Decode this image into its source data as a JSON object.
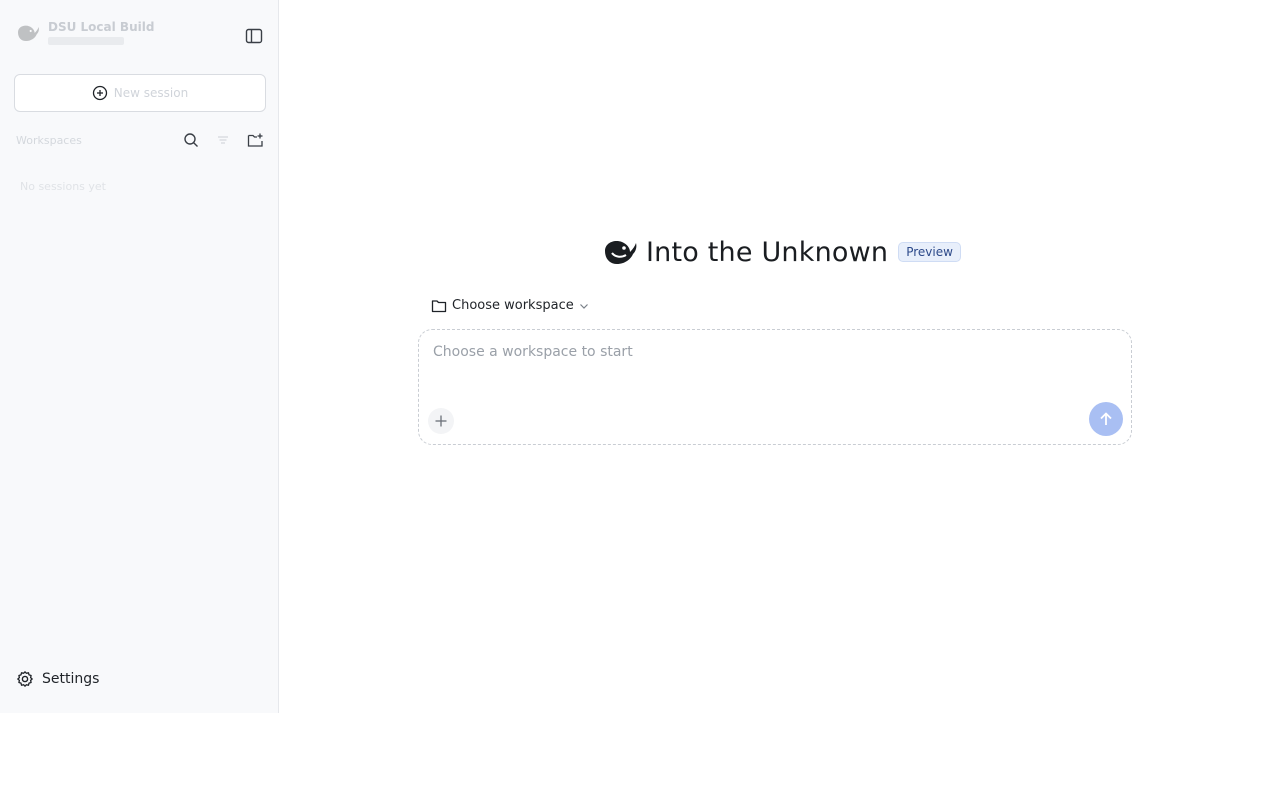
{
  "sidebar": {
    "brand_title": "DSU Local Build",
    "new_session_label": "New session",
    "section_label": "Workspaces",
    "empty_hint": "No sessions yet",
    "settings_label": "Settings"
  },
  "main": {
    "title": "Into the Unknown",
    "badge": "Preview",
    "workspace_select_label": "Choose workspace",
    "composer_placeholder": "Choose a workspace to start"
  },
  "colors": {
    "accent": "#a9bff3",
    "badge_bg": "#e8effb",
    "badge_text": "#2d4a8a",
    "sidebar_bg": "#f8f9fb"
  },
  "icons": {
    "brand": "whale-logo-icon",
    "toggle": "sidebar-toggle-icon",
    "new_session": "plus-circle-icon",
    "search": "search-icon",
    "filter": "filter-icon",
    "new_folder": "folder-plus-icon",
    "settings": "gear-icon",
    "workspace": "folder-icon",
    "chevron": "chevron-down-icon",
    "attach": "plus-icon",
    "send": "arrow-up-icon"
  }
}
